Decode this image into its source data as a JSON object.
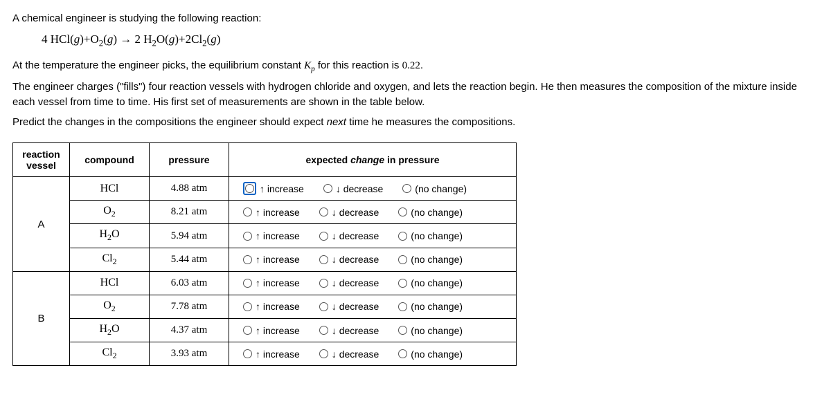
{
  "intro": {
    "l1": "A chemical engineer is studying the following reaction:",
    "eqn": "4 HCl(g) + O₂(g) → 2 H₂O(g) + 2 Cl₂(g)",
    "l2_a": "At the temperature the engineer picks, the equilibrium constant ",
    "l2_kp": "K",
    "l2_kp_sub": "p",
    "l2_b": " for this reaction is ",
    "kp_val": "0.22",
    "l2_c": ".",
    "l3": "The engineer charges (\"fills\") four reaction vessels with hydrogen chloride and oxygen, and lets the reaction begin. He then measures the composition of the mixture inside each vessel from time to time. His first set of measurements are shown in the table below.",
    "l4_a": "Predict the changes in the compositions the engineer should expect ",
    "l4_next": "next",
    "l4_b": " time he measures the compositions."
  },
  "headers": {
    "vessel_a": "reaction",
    "vessel_b": "vessel",
    "compound": "compound",
    "pressure": "pressure",
    "expected_a": "expected ",
    "expected_change": "change",
    "expected_b": " in pressure"
  },
  "options": {
    "inc": "↑ increase",
    "dec": "↓ decrease",
    "none": "(no change)"
  },
  "vessels": [
    {
      "label": "A",
      "rows": [
        {
          "compound": "HCl",
          "pressure": "4.88 atm",
          "focused": true
        },
        {
          "compound": "O₂",
          "pressure": "8.21 atm"
        },
        {
          "compound": "H₂O",
          "pressure": "5.94 atm"
        },
        {
          "compound": "Cl₂",
          "pressure": "5.44 atm"
        }
      ]
    },
    {
      "label": "B",
      "rows": [
        {
          "compound": "HCl",
          "pressure": "6.03 atm"
        },
        {
          "compound": "O₂",
          "pressure": "7.78 atm"
        },
        {
          "compound": "H₂O",
          "pressure": "4.37 atm"
        },
        {
          "compound": "Cl₂",
          "pressure": "3.93 atm"
        }
      ]
    }
  ]
}
